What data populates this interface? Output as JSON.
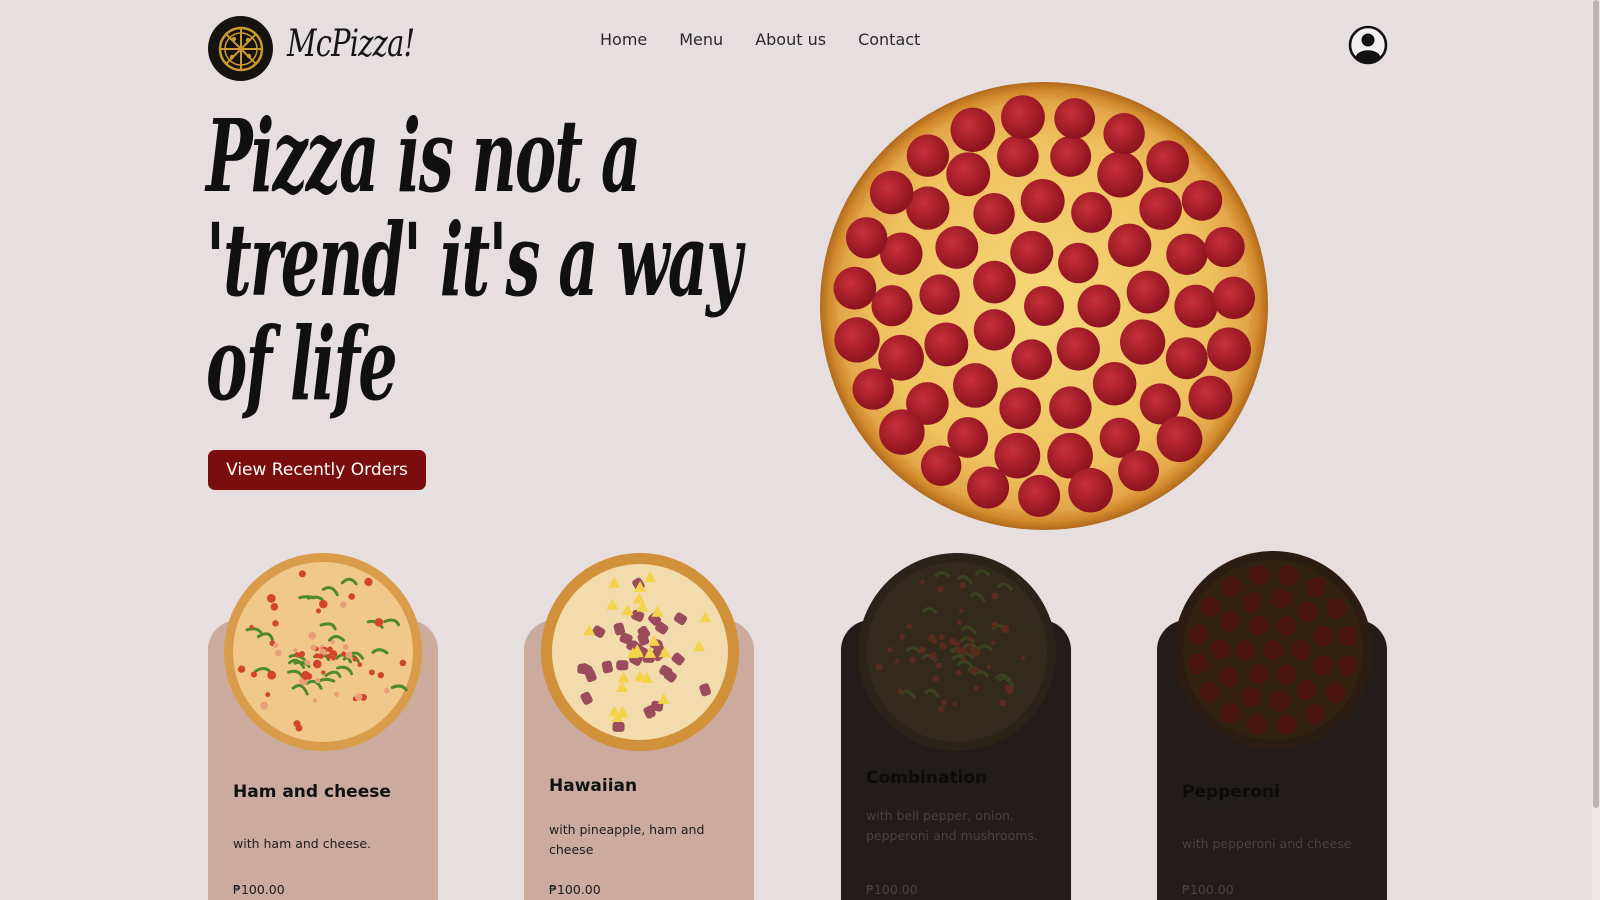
{
  "brand": {
    "name": "McPizza!",
    "logo_icon": "pizza-slices-icon"
  },
  "nav": {
    "items": [
      {
        "label": "Home"
      },
      {
        "label": "Menu"
      },
      {
        "label": "About us"
      },
      {
        "label": "Contact"
      }
    ],
    "profile_icon": "user-profile-icon"
  },
  "hero": {
    "title_lines": [
      "Pizza is not a",
      "'trend' it's a way",
      "of life"
    ],
    "cta_label": "View Recently Orders",
    "image_icon": "pepperoni-pizza-icon"
  },
  "cards": [
    {
      "name": "Ham and cheese",
      "description": "with ham and cheese.",
      "price": "₱100.00",
      "theme": "light",
      "pizza_icon": "ham-cheese-pizza-icon"
    },
    {
      "name": "Hawaiian",
      "description": "with pineapple, ham and cheese",
      "price": "₱100.00",
      "theme": "light",
      "pizza_icon": "hawaiian-pizza-icon"
    },
    {
      "name": "Combination",
      "description": "with bell pepper, onion, pepperoni and mushrooms.",
      "price": "₱100.00",
      "theme": "dark",
      "pizza_icon": "combination-pizza-icon"
    },
    {
      "name": "Pepperoni",
      "description": "with pepperoni and cheese",
      "price": "₱100.00",
      "theme": "dark",
      "pizza_icon": "pepperoni-pizza-icon"
    }
  ],
  "colors": {
    "background": "#e7dfdf",
    "accent": "#7a0d0d",
    "card_light": "#ccab9f",
    "card_dark": "#221c1b"
  }
}
